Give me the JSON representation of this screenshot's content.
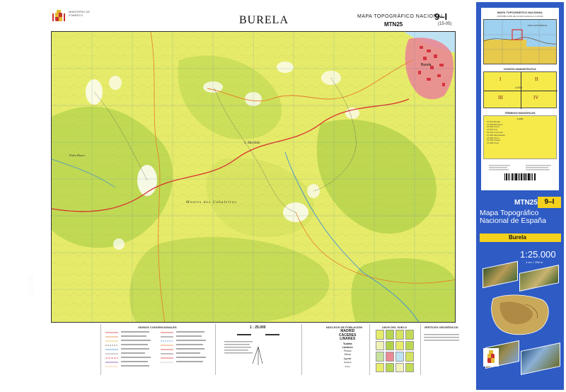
{
  "header": {
    "ministry": "MINISTERIO DE FOMENTO",
    "title": "BURELA",
    "series_name": "MAPA TOPOGRÁFICO NACIONAL",
    "series_code": "MTN25",
    "sheet": "9–I",
    "sheet_sub": "(15-05)"
  },
  "map": {
    "labels": {
      "place_burela": "Burela",
      "place_mariñan": "S. Mariñán",
      "range": "Montes dos Cabaleiros",
      "valley": "Pedra Moura"
    },
    "colors": {
      "terrain": "#e6ec6a",
      "forest": "#b6d64f",
      "urban": "#e24b5c",
      "sea": "#bfe2f3"
    }
  },
  "cover": {
    "index_title": "MAPA TOPOGRÁFICO NACIONAL",
    "index_sub": "DISTRIBUCIÓN DE HOJAS A ESCALA 1:25.000",
    "index_label": "MAR CANTÁBRICO",
    "admin_title": "DIVISIÓN ADMINISTRATIVA",
    "admin_nums": [
      "I",
      "II",
      "III",
      "IV"
    ],
    "admin_label": "LUGO",
    "term_title": "TÉRMINOS MUNICIPALES",
    "term_list": [
      "LUGO",
      "27-014 Burela",
      "27-006 Barreiros",
      "27-022 Cervo",
      "27-031 Foz",
      "27-044 Lourenzá",
      "27-050 Mondoñedo",
      "27-065 Ourol",
      "27-066 Viveiro",
      "27-903 Xove"
    ],
    "code": "MTN25",
    "sheet": "9–I",
    "title": "Mapa Topográfico Nacional de España",
    "place": "Burela",
    "scale": "1:25.000",
    "ratio": "1 cm = 250 m"
  },
  "legend": {
    "signos_title": "SIGNOS CONVENCIONALES",
    "scale_title": "1 : 25.000",
    "nucleos_title": "NÚCLEOS DE POBLACIÓN",
    "towns": [
      "MADRID",
      "CÁCERES",
      "LINARES",
      "Tudela",
      "Lardero",
      "Pinoso",
      "Sierra",
      "Aguilar",
      "Nobaza",
      "Pozo"
    ],
    "usos_title": "USOS DEL SUELO",
    "vertices_title": "VÉRTICES GEODÉSICOS"
  }
}
